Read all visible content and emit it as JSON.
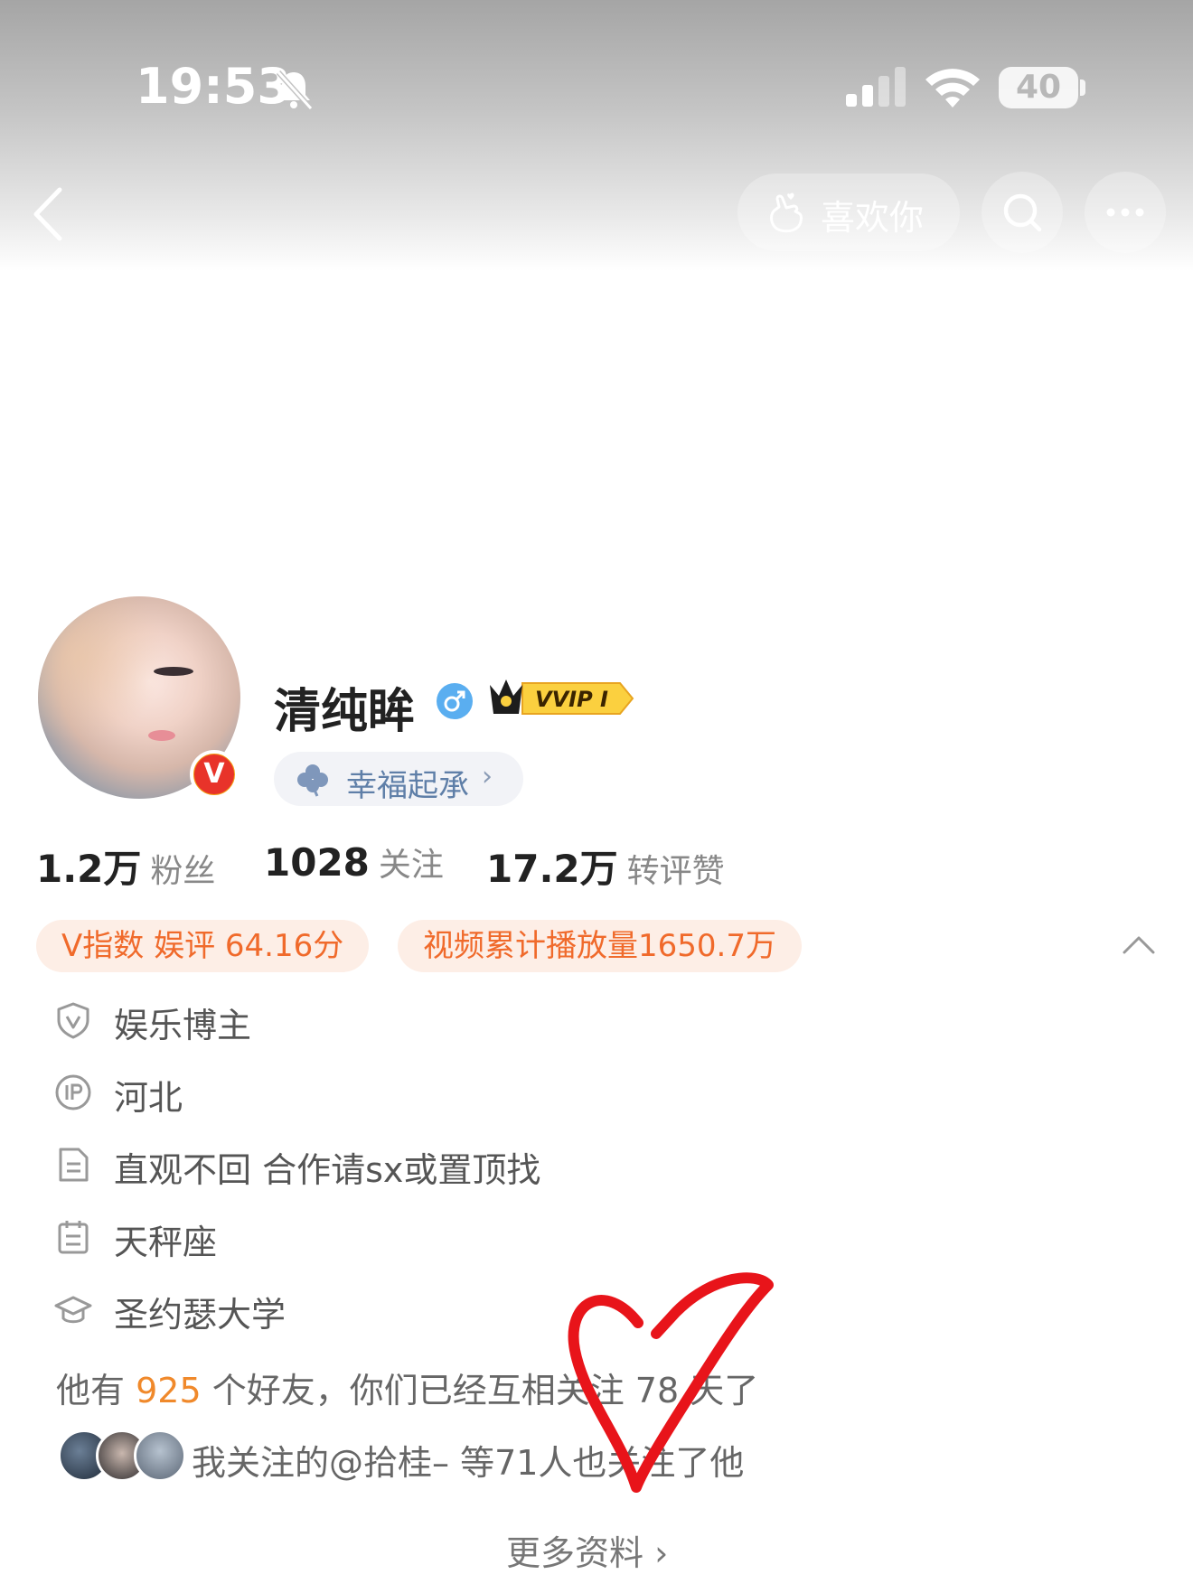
{
  "status_bar": {
    "time": "19:53",
    "battery": "40"
  },
  "nav": {
    "like_you_label": "喜欢你"
  },
  "profile": {
    "username": "清纯眸",
    "vvip_label": "VVIP I",
    "group_label": "幸福起承",
    "group_chevron": "›"
  },
  "stats": [
    {
      "value": "1.2万",
      "label": "粉丝"
    },
    {
      "value": "1028",
      "label": "关注"
    },
    {
      "value": "17.2万",
      "label": "转评赞"
    }
  ],
  "tags": [
    "V指数 娱评 64.16分",
    "视频累计播放量1650.7万"
  ],
  "info_rows": [
    {
      "icon": "shield-v-icon",
      "text": "娱乐博主"
    },
    {
      "icon": "ip-icon",
      "text": "河北"
    },
    {
      "icon": "document-icon",
      "text": "直观不回 合作请sx或置顶找"
    },
    {
      "icon": "calendar-icon",
      "text": "天秤座"
    },
    {
      "icon": "graduation-cap-icon",
      "text": "圣约瑟大学"
    }
  ],
  "friends": {
    "prefix": "他有 ",
    "count": "925",
    "suffix": " 个好友，你们已经互相关注 78 天了"
  },
  "mutual_follow": {
    "text": "我关注的@拾桂– 等71人也关注了他"
  },
  "more_info": {
    "label": "更多资料",
    "chevron": "›"
  },
  "colors": {
    "accent_orange": "#f06a2b",
    "tag_bg": "#fdeee6",
    "group_blue": "#5f7fa8",
    "heart_red": "#e8141a"
  }
}
